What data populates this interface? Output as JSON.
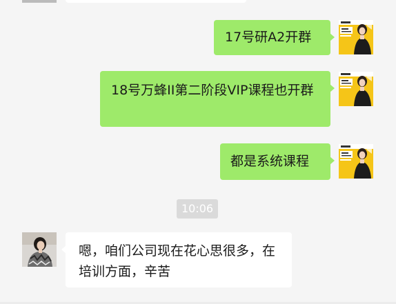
{
  "chat": {
    "messages": [
      {
        "side": "me",
        "text": "17号研A2开群"
      },
      {
        "side": "me",
        "text": "18号万蜂II第二阶段VIP课程也开群"
      },
      {
        "side": "me",
        "text": "都是系统课程"
      },
      {
        "side": "other",
        "text": "嗯，咱们公司现在花心思很多，在培训方面，辛苦"
      }
    ],
    "timestamp": "10:06"
  },
  "colors": {
    "me_bubble": "#9eea6a",
    "other_bubble": "#ffffff",
    "background": "#f5f5f5",
    "timestamp_bg": "#dadada"
  },
  "icons": {
    "me_avatar": "woman-poster-avatar-icon",
    "other_avatar": "woman-photo-avatar-icon"
  }
}
